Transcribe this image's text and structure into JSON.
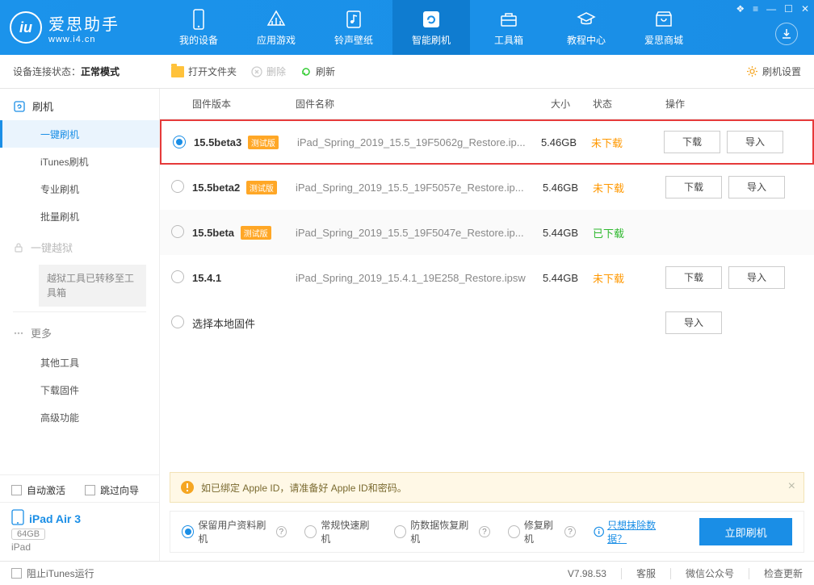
{
  "app": {
    "name": "爱思助手",
    "url": "www.i4.cn"
  },
  "nav": {
    "tabs": [
      {
        "label": "我的设备"
      },
      {
        "label": "应用游戏"
      },
      {
        "label": "铃声壁纸"
      },
      {
        "label": "智能刷机"
      },
      {
        "label": "工具箱"
      },
      {
        "label": "教程中心"
      },
      {
        "label": "爱思商城"
      }
    ]
  },
  "toolbar": {
    "conn_label": "设备连接状态：",
    "conn_status": "正常模式",
    "open_folder": "打开文件夹",
    "delete": "删除",
    "refresh": "刷新",
    "settings": "刷机设置"
  },
  "sidebar": {
    "flash_group": "刷机",
    "items": {
      "oneclick": "一键刷机",
      "itunes": "iTunes刷机",
      "pro": "专业刷机",
      "batch": "批量刷机"
    },
    "jailbreak": "一键越狱",
    "jb_notice": "越狱工具已转移至工具箱",
    "more": "更多",
    "more_items": {
      "other_tools": "其他工具",
      "download_fw": "下载固件",
      "advanced": "高级功能"
    },
    "auto_activate": "自动激活",
    "skip_guide": "跳过向导",
    "device_name": "iPad Air 3",
    "device_cap": "64GB",
    "device_type": "iPad"
  },
  "table": {
    "headers": {
      "version": "固件版本",
      "name": "固件名称",
      "size": "大小",
      "status": "状态",
      "actions": "操作"
    },
    "beta_tag": "测试版",
    "local_fw": "选择本地固件",
    "rows": [
      {
        "version": "15.5beta3",
        "beta": true,
        "name": "iPad_Spring_2019_15.5_19F5062g_Restore.ip...",
        "size": "5.46GB",
        "status": "未下载",
        "status_class": "orange",
        "download": true,
        "import": true,
        "selected": true
      },
      {
        "version": "15.5beta2",
        "beta": true,
        "name": "iPad_Spring_2019_15.5_19F5057e_Restore.ip...",
        "size": "5.46GB",
        "status": "未下载",
        "status_class": "orange",
        "download": true,
        "import": true,
        "selected": false
      },
      {
        "version": "15.5beta",
        "beta": true,
        "name": "iPad_Spring_2019_15.5_19F5047e_Restore.ip...",
        "size": "5.44GB",
        "status": "已下载",
        "status_class": "green",
        "download": false,
        "import": false,
        "selected": false
      },
      {
        "version": "15.4.1",
        "beta": false,
        "name": "iPad_Spring_2019_15.4.1_19E258_Restore.ipsw",
        "size": "5.44GB",
        "status": "未下载",
        "status_class": "orange",
        "download": true,
        "import": true,
        "selected": false
      }
    ],
    "btn_download": "下载",
    "btn_import": "导入"
  },
  "notice": "如已绑定 Apple ID，请准备好 Apple ID和密码。",
  "options": {
    "keep_data": "保留用户资料刷机",
    "normal": "常规快速刷机",
    "antirecovery": "防数据恢复刷机",
    "repair": "修复刷机",
    "erase_link": "只想抹除数据？",
    "flash_now": "立即刷机"
  },
  "footer": {
    "block_itunes": "阻止iTunes运行",
    "version": "V7.98.53",
    "support": "客服",
    "wechat": "微信公众号",
    "update": "检查更新"
  }
}
